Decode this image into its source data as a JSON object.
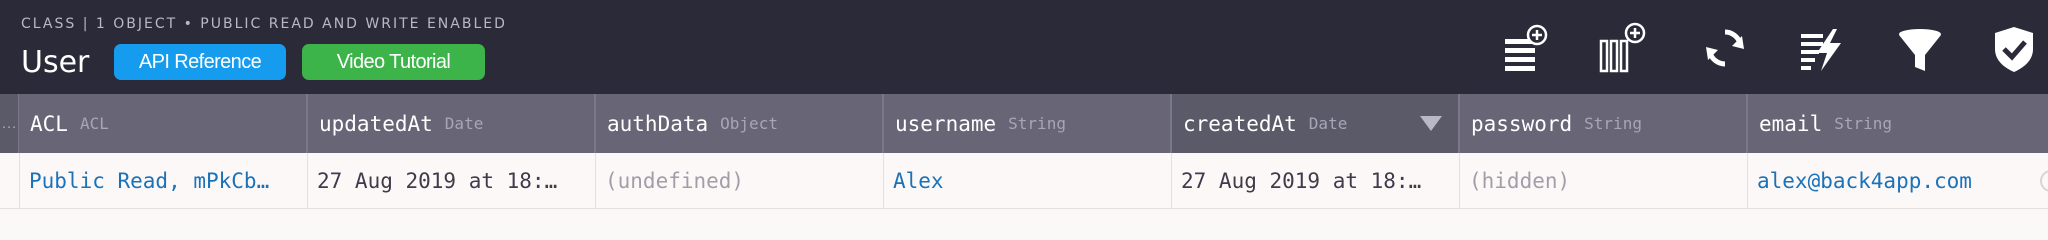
{
  "toolbar": {
    "subtitle": "CLASS | 1 OBJECT • PUBLIC READ AND WRITE ENABLED",
    "class_name": "User",
    "api_reference_label": "API Reference",
    "video_tutorial_label": "Video Tutorial",
    "tools": [
      {
        "icon": "add-row-icon"
      },
      {
        "icon": "add-column-icon"
      },
      {
        "icon": "refresh-icon"
      },
      {
        "icon": "cloud-code-icon"
      },
      {
        "icon": "filter-icon"
      },
      {
        "icon": "security-icon"
      }
    ]
  },
  "columns": [
    {
      "name": "ACL",
      "type": "ACL"
    },
    {
      "name": "updatedAt",
      "type": "Date"
    },
    {
      "name": "authData",
      "type": "Object"
    },
    {
      "name": "username",
      "type": "String"
    },
    {
      "name": "createdAt",
      "type": "Date",
      "sorted": "descending"
    },
    {
      "name": "password",
      "type": "String"
    },
    {
      "name": "email",
      "type": "String"
    }
  ],
  "rows": [
    {
      "ACL": "Public Read, mPkCb…",
      "updatedAt": "27 Aug 2019 at 18:…",
      "authData": "(undefined)",
      "username": "Alex",
      "createdAt": "27 Aug 2019 at 18:…",
      "password": "(hidden)",
      "email": "alex@back4app.com"
    }
  ],
  "colors": {
    "toolbar_bg": "#2b2a38",
    "header_bg": "#676576",
    "api_pill": "#169cee",
    "video_pill": "#3cb449",
    "link": "#1a72b9"
  }
}
